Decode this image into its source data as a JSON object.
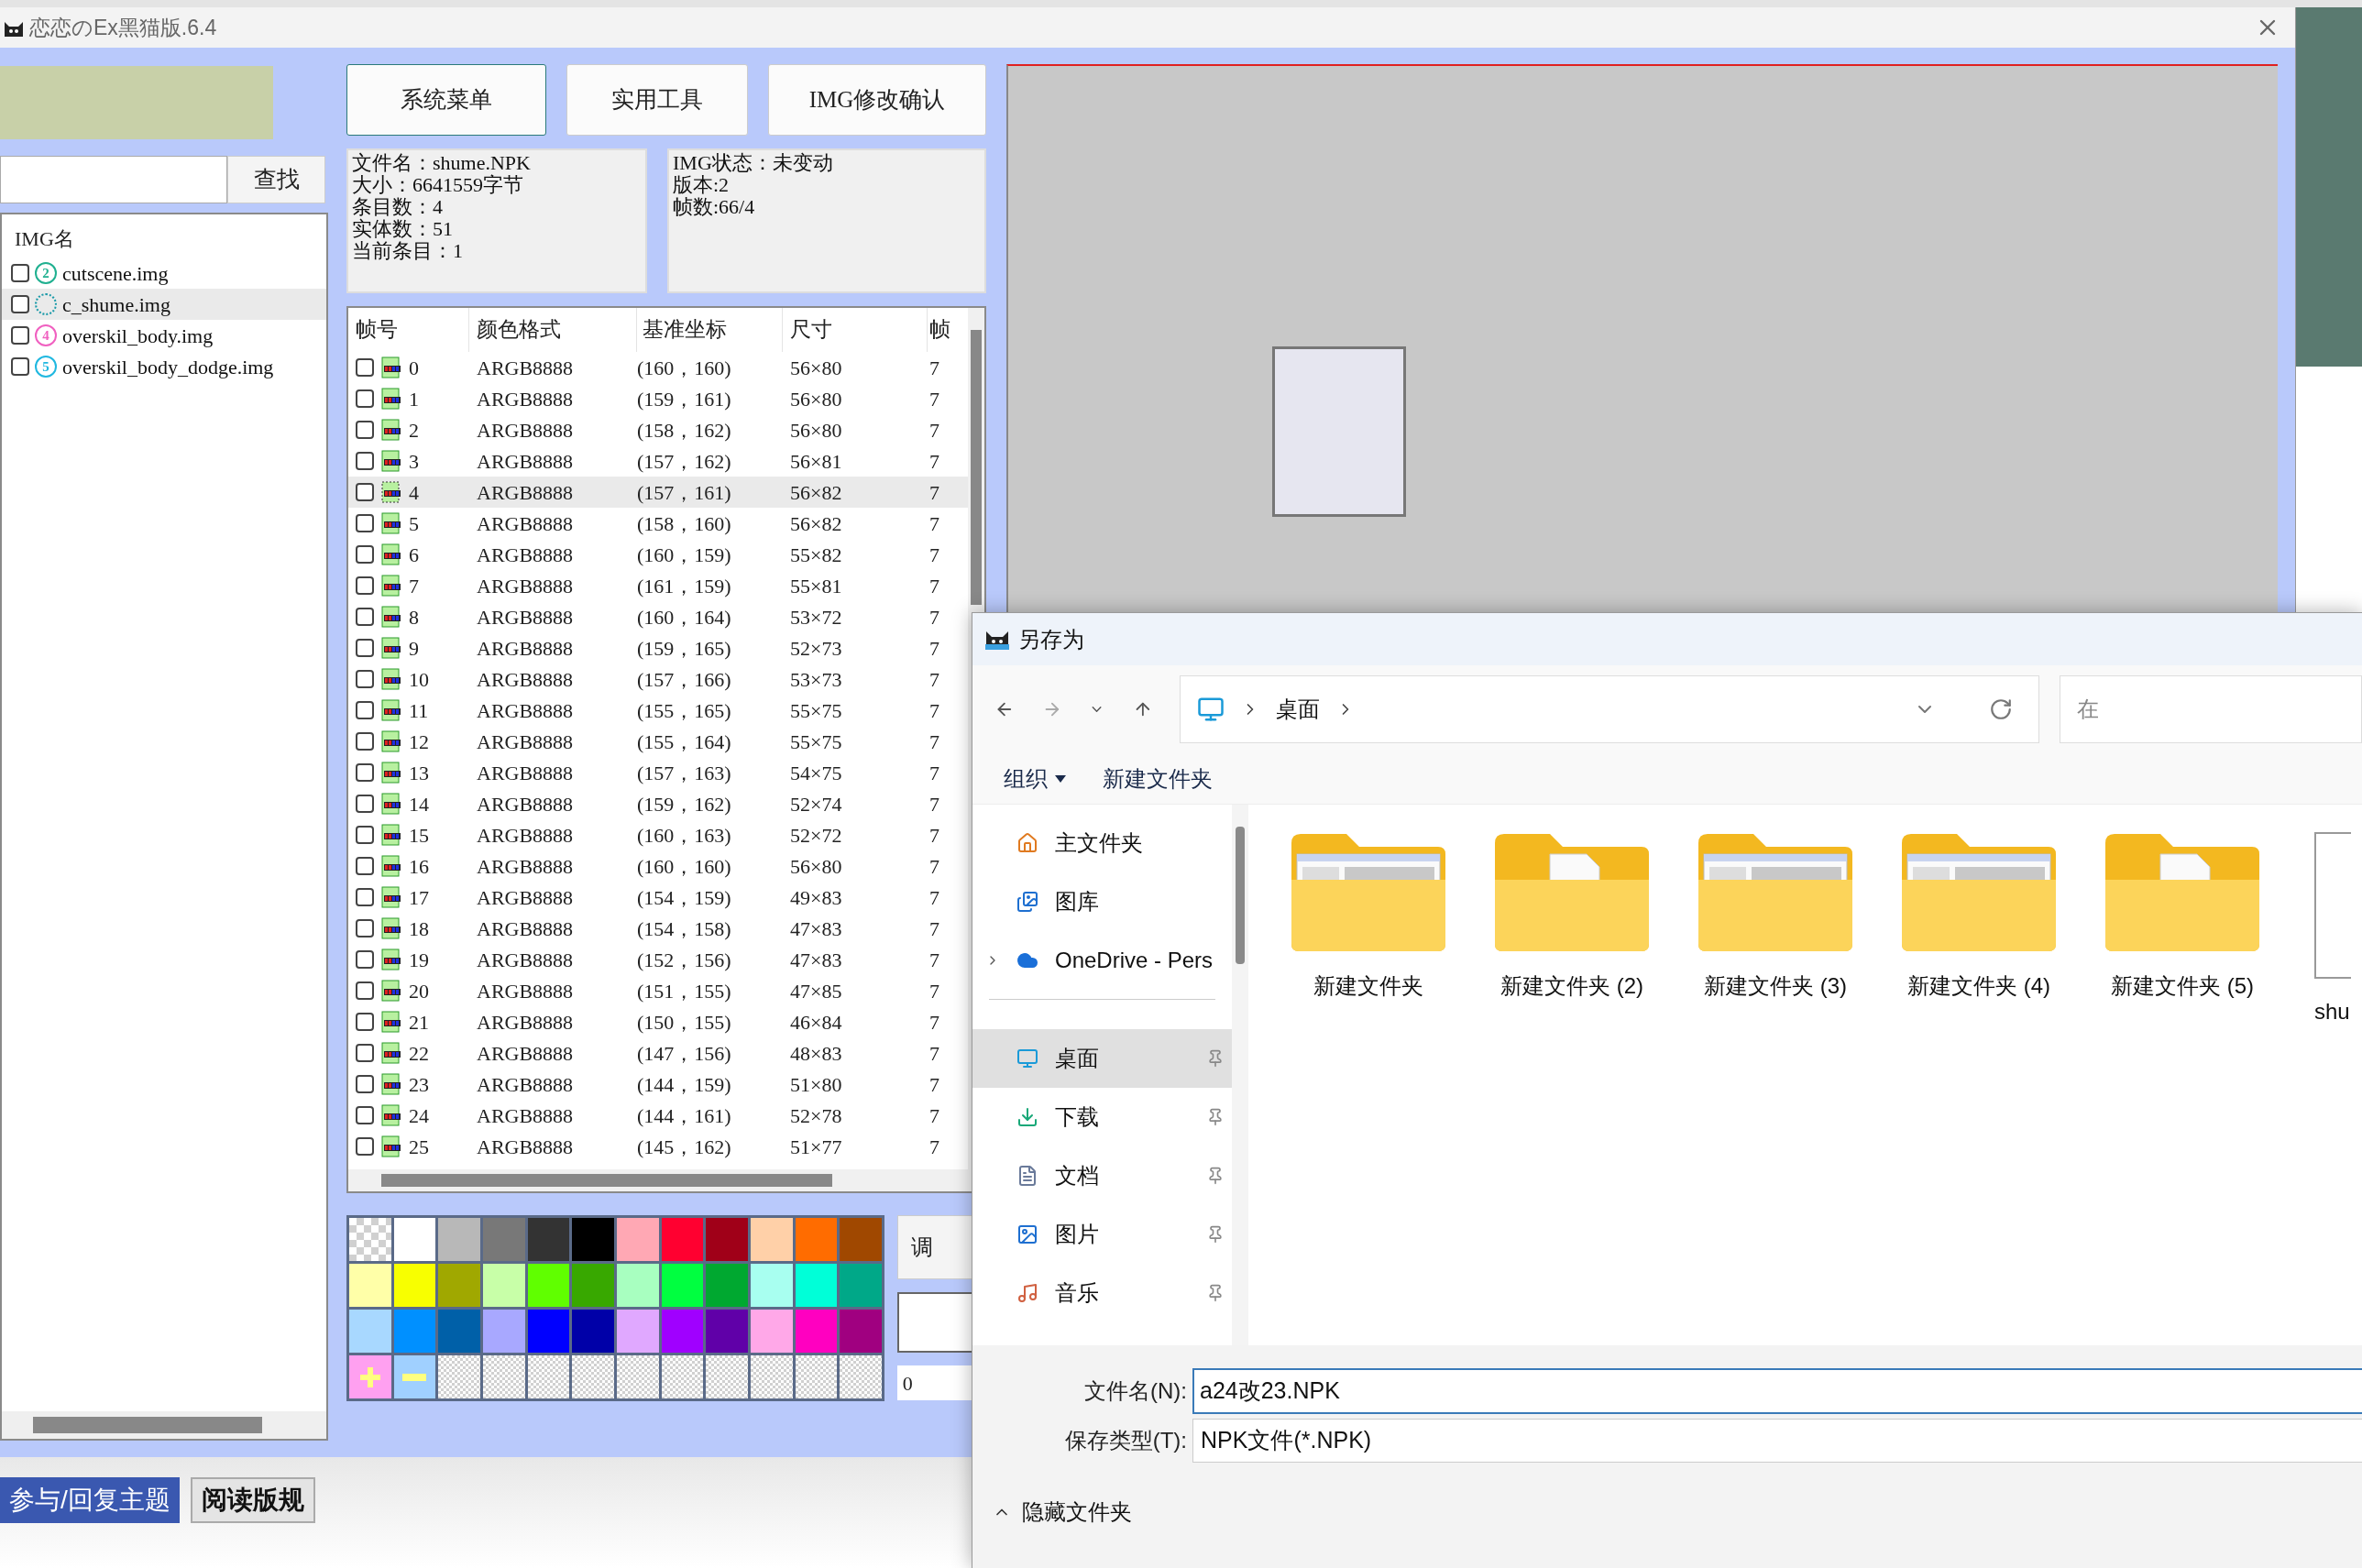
{
  "app": {
    "title": "恋恋のEx黑猫版.6.4",
    "search_button": "查找",
    "img_list": {
      "header": "IMG名",
      "items": [
        {
          "name": "cutscene.img",
          "badge": "2",
          "color": "#20b090",
          "checked": false,
          "selected": false
        },
        {
          "name": "c_shume.img",
          "color": "#1a9aa8",
          "checked": false,
          "selected": true
        },
        {
          "name": "overskil_body.img",
          "badge": "4",
          "color": "#f060c0",
          "checked": false,
          "selected": false
        },
        {
          "name": "overskil_body_dodge.img",
          "badge": "5",
          "color": "#20b8e0",
          "checked": false,
          "selected": false
        }
      ]
    },
    "menu_buttons": [
      "系统菜单",
      "实用工具",
      "IMG修改确认"
    ],
    "file_info": [
      "文件名：shume.NPK",
      "大小：6641559字节",
      "条目数：4",
      "实体数：51",
      "当前条目：1"
    ],
    "img_info": [
      "IMG状态：未变动",
      "版本:2",
      "帧数:66/4"
    ],
    "frames": {
      "columns": [
        "帧号",
        "颜色格式",
        "基准坐标",
        "尺寸",
        "帧"
      ],
      "rows": [
        {
          "index": "0",
          "format": "ARGB8888",
          "coord": "(160，160)",
          "size": "56×80",
          "column_5": "7",
          "checked": false,
          "selected": false
        },
        {
          "index": "1",
          "format": "ARGB8888",
          "coord": "(159，161)",
          "size": "56×80",
          "column_5": "7",
          "checked": false,
          "selected": false
        },
        {
          "index": "2",
          "format": "ARGB8888",
          "coord": "(158，162)",
          "size": "56×80",
          "column_5": "7",
          "checked": false,
          "selected": false
        },
        {
          "index": "3",
          "format": "ARGB8888",
          "coord": "(157，162)",
          "size": "56×81",
          "column_5": "7",
          "checked": false,
          "selected": false
        },
        {
          "index": "4",
          "format": "ARGB8888",
          "coord": "(157，161)",
          "size": "56×82",
          "column_5": "7",
          "checked": false,
          "selected": true
        },
        {
          "index": "5",
          "format": "ARGB8888",
          "coord": "(158，160)",
          "size": "56×82",
          "column_5": "7",
          "checked": false,
          "selected": false
        },
        {
          "index": "6",
          "format": "ARGB8888",
          "coord": "(160，159)",
          "size": "55×82",
          "column_5": "7",
          "checked": false,
          "selected": false
        },
        {
          "index": "7",
          "format": "ARGB8888",
          "coord": "(161，159)",
          "size": "55×81",
          "column_5": "7",
          "checked": false,
          "selected": false
        },
        {
          "index": "8",
          "format": "ARGB8888",
          "coord": "(160，164)",
          "size": "53×72",
          "column_5": "7",
          "checked": false,
          "selected": false
        },
        {
          "index": "9",
          "format": "ARGB8888",
          "coord": "(159，165)",
          "size": "52×73",
          "column_5": "7",
          "checked": false,
          "selected": false
        },
        {
          "index": "10",
          "format": "ARGB8888",
          "coord": "(157，166)",
          "size": "53×73",
          "column_5": "7",
          "checked": false,
          "selected": false
        },
        {
          "index": "11",
          "format": "ARGB8888",
          "coord": "(155，165)",
          "size": "55×75",
          "column_5": "7",
          "checked": false,
          "selected": false
        },
        {
          "index": "12",
          "format": "ARGB8888",
          "coord": "(155，164)",
          "size": "55×75",
          "column_5": "7",
          "checked": false,
          "selected": false
        },
        {
          "index": "13",
          "format": "ARGB8888",
          "coord": "(157，163)",
          "size": "54×75",
          "column_5": "7",
          "checked": false,
          "selected": false
        },
        {
          "index": "14",
          "format": "ARGB8888",
          "coord": "(159，162)",
          "size": "52×74",
          "column_5": "7",
          "checked": false,
          "selected": false
        },
        {
          "index": "15",
          "format": "ARGB8888",
          "coord": "(160，163)",
          "size": "52×72",
          "column_5": "7",
          "checked": false,
          "selected": false
        },
        {
          "index": "16",
          "format": "ARGB8888",
          "coord": "(160，160)",
          "size": "56×80",
          "column_5": "7",
          "checked": false,
          "selected": false
        },
        {
          "index": "17",
          "format": "ARGB8888",
          "coord": "(154，159)",
          "size": "49×83",
          "column_5": "7",
          "checked": false,
          "selected": false
        },
        {
          "index": "18",
          "format": "ARGB8888",
          "coord": "(154，158)",
          "size": "47×83",
          "column_5": "7",
          "checked": false,
          "selected": false
        },
        {
          "index": "19",
          "format": "ARGB8888",
          "coord": "(152，156)",
          "size": "47×83",
          "column_5": "7",
          "checked": false,
          "selected": false
        },
        {
          "index": "20",
          "format": "ARGB8888",
          "coord": "(151，155)",
          "size": "47×85",
          "column_5": "7",
          "checked": false,
          "selected": false
        },
        {
          "index": "21",
          "format": "ARGB8888",
          "coord": "(150，155)",
          "size": "46×84",
          "column_5": "7",
          "checked": false,
          "selected": false
        },
        {
          "index": "22",
          "format": "ARGB8888",
          "coord": "(147，156)",
          "size": "48×83",
          "column_5": "7",
          "checked": false,
          "selected": false
        },
        {
          "index": "23",
          "format": "ARGB8888",
          "coord": "(144，159)",
          "size": "51×80",
          "column_5": "7",
          "checked": false,
          "selected": false
        },
        {
          "index": "24",
          "format": "ARGB8888",
          "coord": "(144，161)",
          "size": "52×78",
          "column_5": "7",
          "checked": false,
          "selected": false
        },
        {
          "index": "25",
          "format": "ARGB8888",
          "coord": "(145，162)",
          "size": "51×77",
          "column_5": "7",
          "checked": false,
          "selected": false
        }
      ]
    },
    "palette": [
      {
        "kind": "transparent"
      },
      {
        "kind": "color",
        "color": "#ffffff"
      },
      {
        "kind": "color",
        "color": "#b8b8b8"
      },
      {
        "kind": "color",
        "color": "#787878"
      },
      {
        "kind": "color",
        "color": "#333333"
      },
      {
        "kind": "color",
        "color": "#000000"
      },
      {
        "kind": "color",
        "color": "#ffa8b4"
      },
      {
        "kind": "color",
        "color": "#ff0030"
      },
      {
        "kind": "color",
        "color": "#a00018"
      },
      {
        "kind": "color",
        "color": "#ffd0a8"
      },
      {
        "kind": "color",
        "color": "#ff6c00"
      },
      {
        "kind": "color",
        "color": "#a04800"
      },
      {
        "kind": "color",
        "color": "#ffffa8"
      },
      {
        "kind": "color",
        "color": "#f8ff00"
      },
      {
        "kind": "color",
        "color": "#a0a800"
      },
      {
        "kind": "color",
        "color": "#c8ffa8"
      },
      {
        "kind": "color",
        "color": "#60ff00"
      },
      {
        "kind": "color",
        "color": "#38a800"
      },
      {
        "kind": "color",
        "color": "#a8ffc0"
      },
      {
        "kind": "color",
        "color": "#00ff40"
      },
      {
        "kind": "color",
        "color": "#00a830"
      },
      {
        "kind": "color",
        "color": "#a8fff0"
      },
      {
        "kind": "color",
        "color": "#00ffd8"
      },
      {
        "kind": "color",
        "color": "#00a888"
      },
      {
        "kind": "color",
        "color": "#a8d8ff"
      },
      {
        "kind": "color",
        "color": "#0090ff"
      },
      {
        "kind": "color",
        "color": "#0060a8"
      },
      {
        "kind": "color",
        "color": "#a8a8ff"
      },
      {
        "kind": "color",
        "color": "#0000ff"
      },
      {
        "kind": "color",
        "color": "#0000a8"
      },
      {
        "kind": "color",
        "color": "#e0a8ff"
      },
      {
        "kind": "color",
        "color": "#a000ff"
      },
      {
        "kind": "color",
        "color": "#6000a8"
      },
      {
        "kind": "color",
        "color": "#ffa8e8"
      },
      {
        "kind": "color",
        "color": "#ff00c0"
      },
      {
        "kind": "color",
        "color": "#a00080"
      },
      {
        "kind": "add"
      },
      {
        "kind": "remove"
      },
      {
        "kind": "empty"
      },
      {
        "kind": "empty"
      },
      {
        "kind": "empty"
      },
      {
        "kind": "empty"
      },
      {
        "kind": "empty"
      },
      {
        "kind": "empty"
      },
      {
        "kind": "empty"
      },
      {
        "kind": "empty"
      },
      {
        "kind": "empty"
      },
      {
        "kind": "empty"
      }
    ],
    "adjust_button": "调",
    "value_select": "0"
  },
  "dialog": {
    "title": "另存为",
    "address": [
      "桌面"
    ],
    "search_placeholder": "在",
    "toolbar": [
      {
        "label": "组织",
        "menu": true
      },
      {
        "label": "新建文件夹",
        "menu": false
      }
    ],
    "nav_top": [
      {
        "label": "主文件夹",
        "expandable": false
      },
      {
        "label": "图库",
        "expandable": false
      },
      {
        "label": "OneDrive - Pers",
        "expandable": true
      }
    ],
    "nav_pinned": [
      {
        "label": "桌面",
        "pinned": true,
        "selected": true
      },
      {
        "label": "下载",
        "pinned": true,
        "selected": false
      },
      {
        "label": "文档",
        "pinned": true,
        "selected": false
      },
      {
        "label": "图片",
        "pinned": true,
        "selected": false
      },
      {
        "label": "音乐",
        "pinned": true,
        "selected": false
      }
    ],
    "items": [
      {
        "name": "新建文件夹",
        "kind": "windowfolder"
      },
      {
        "name": "新建文件夹 (2)",
        "kind": "docfolder"
      },
      {
        "name": "新建文件夹 (3)",
        "kind": "windowfolder"
      },
      {
        "name": "新建文件夹 (4)",
        "kind": "windowfolder"
      },
      {
        "name": "新建文件夹 (5)",
        "kind": "docfolder"
      },
      {
        "name": "shu",
        "kind": "file"
      }
    ],
    "file_name_label": "文件名(N):",
    "file_name": "a24改23.NPK",
    "file_type_label": "保存类型(T):",
    "file_type": "NPK文件(*.NPK)",
    "hide_folders": "隐藏文件夹"
  },
  "browser_page": {
    "buttons": [
      {
        "label": "参与/回复主题",
        "kind": "primary"
      },
      {
        "label": "阅读版规",
        "kind": "secondary"
      }
    ]
  }
}
